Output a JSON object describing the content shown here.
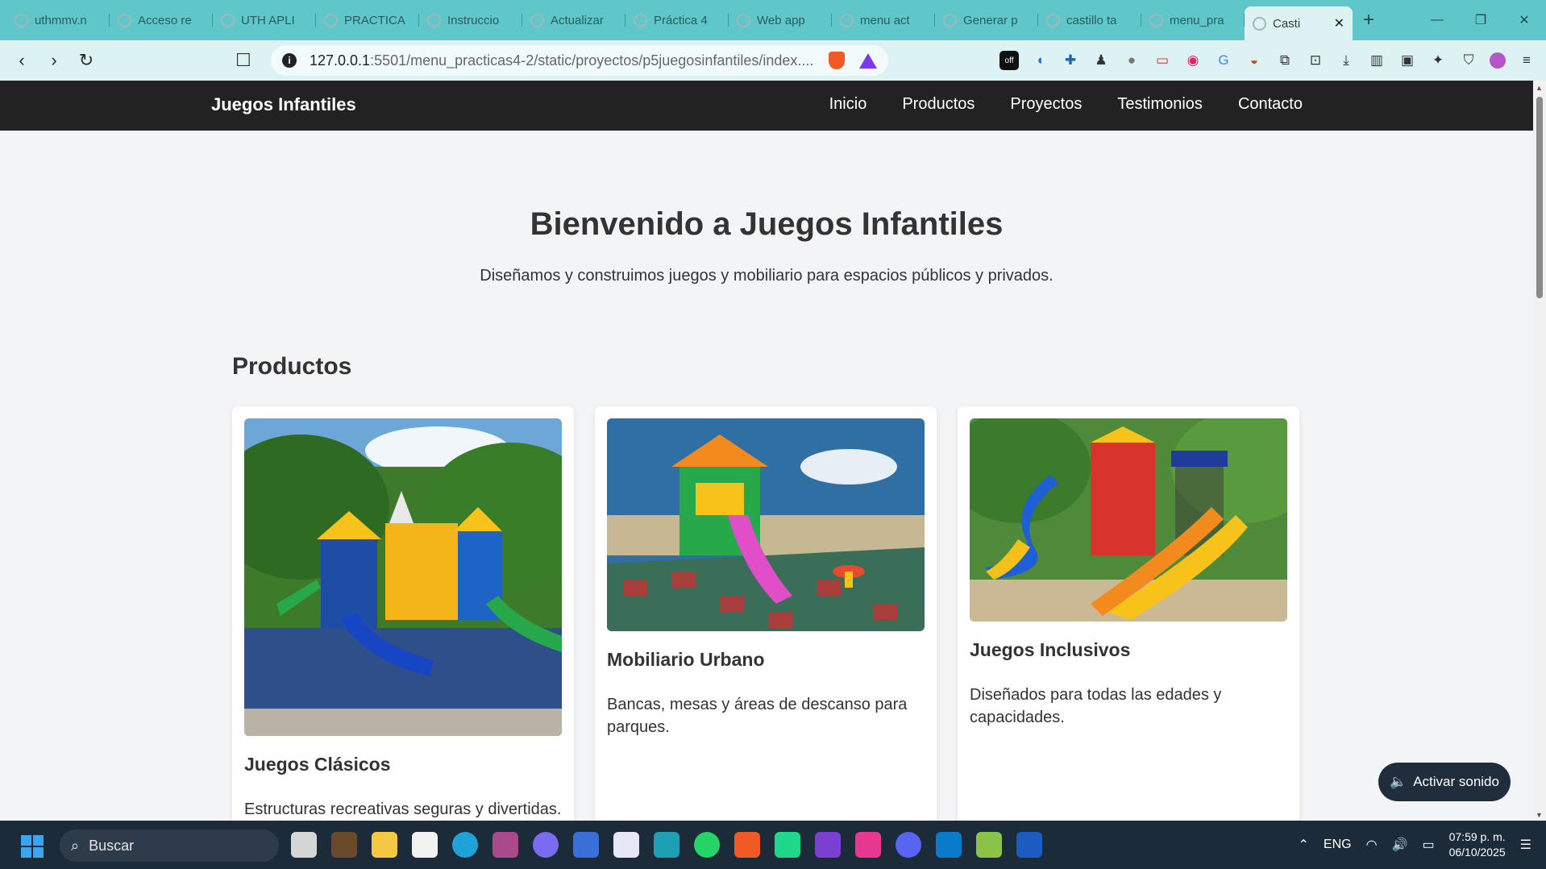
{
  "tabs": [
    {
      "label": "uthmmv.n"
    },
    {
      "label": "Acceso re"
    },
    {
      "label": "UTH APLI"
    },
    {
      "label": "PRACTICA"
    },
    {
      "label": "Instruccio"
    },
    {
      "label": "Actualizar"
    },
    {
      "label": "Práctica 4"
    },
    {
      "label": "Web app"
    },
    {
      "label": "menu act"
    },
    {
      "label": "Generar p"
    },
    {
      "label": "castillo ta"
    },
    {
      "label": "menu_pra"
    },
    {
      "label": "Casti"
    }
  ],
  "newtab_symbol": "+",
  "address": {
    "host": "127.0.0.1",
    "path": ":5501/menu_practicas4-2/static/proyectos/p5juegosinfantiles/index...."
  },
  "extensions": [
    "off-badge-icon",
    "audio-icon",
    "extension-blue-icon",
    "pawn-icon",
    "owl-icon",
    "cast-icon",
    "color-icon",
    "translate-icon",
    "game-icon",
    "puzzle-icon",
    "screenshot-icon",
    "download-icon",
    "sidepanel-icon",
    "wallet-icon",
    "ai-icon",
    "shield-icon",
    "profile-icon",
    "menu-icon"
  ],
  "site": {
    "brand": "Juegos Infantiles",
    "menu": [
      "Inicio",
      "Productos",
      "Proyectos",
      "Testimonios",
      "Contacto"
    ]
  },
  "hero": {
    "title": "Bienvenido a Juegos Infantiles",
    "subtitle": "Diseñamos y construimos juegos y mobiliario para espacios públicos y privados."
  },
  "products_title": "Productos",
  "products": [
    {
      "title": "Juegos Clásicos",
      "description": "Estructuras recreativas seguras y divertidas."
    },
    {
      "title": "Mobiliario Urbano",
      "description": "Bancas, mesas y áreas de descanso para parques."
    },
    {
      "title": "Juegos Inclusivos",
      "description": "Diseñados para todas las edades y capacidades."
    }
  ],
  "sound_button": {
    "icon": "speaker-icon",
    "label": "Activar sonido"
  },
  "taskbar": {
    "search_placeholder": "Buscar",
    "language": "ENG",
    "time": "07:59 p. m.",
    "date": "06/10/2025"
  },
  "colors": {
    "tabstrip": "#5fc6c9",
    "toolbar": "#ddf3f3",
    "site_nav": "#222222",
    "page_bg": "#f3f4f6",
    "taskbar": "#1c2b3a",
    "sound_button": "#1f2d3d"
  }
}
